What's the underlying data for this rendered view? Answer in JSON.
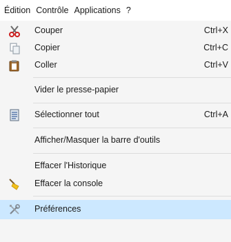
{
  "menubar": {
    "items": [
      "Édition",
      "Contrôle",
      "Applications",
      "?"
    ]
  },
  "menu": {
    "items": [
      {
        "label": "Couper",
        "shortcut": "Ctrl+X",
        "icon": "scissors-icon"
      },
      {
        "label": "Copier",
        "shortcut": "Ctrl+C",
        "icon": "copy-icon"
      },
      {
        "label": "Coller",
        "shortcut": "Ctrl+V",
        "icon": "paste-icon"
      },
      {
        "label": "Vider le presse-papier"
      },
      {
        "label": "Sélectionner tout",
        "shortcut": "Ctrl+A",
        "icon": "select-all-icon"
      },
      {
        "label": "Afficher/Masquer la barre d'outils"
      },
      {
        "label": "Effacer l'Historique"
      },
      {
        "label": "Effacer la console",
        "icon": "broom-icon"
      },
      {
        "label": "Préférences",
        "icon": "tools-icon",
        "highlighted": true
      }
    ]
  },
  "colors": {
    "highlight": "#cce8ff",
    "menu_background": "#f5f5f5"
  }
}
